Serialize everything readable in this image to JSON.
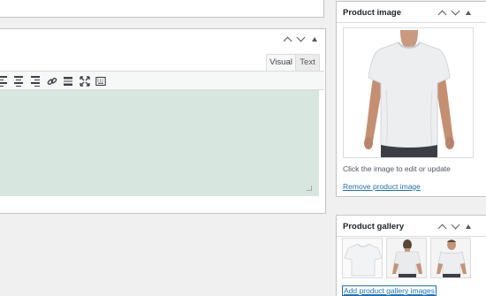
{
  "editor": {
    "tabs": [
      "Visual",
      "Text"
    ],
    "toolbar_icons": [
      "align-left-icon",
      "align-center-icon",
      "align-right-icon",
      "link-icon",
      "read-more-icon",
      "fullscreen-icon",
      "toolbar-toggle-icon"
    ]
  },
  "product_image": {
    "title": "Product image",
    "help_text": "Click the image to edit or update",
    "remove_link": "Remove product image"
  },
  "product_gallery": {
    "title": "Product gallery",
    "thumbnail_count": 3,
    "add_link": "Add product gallery images"
  },
  "colors": {
    "editor_background": "#d7e6df",
    "link": "#2271b1"
  }
}
